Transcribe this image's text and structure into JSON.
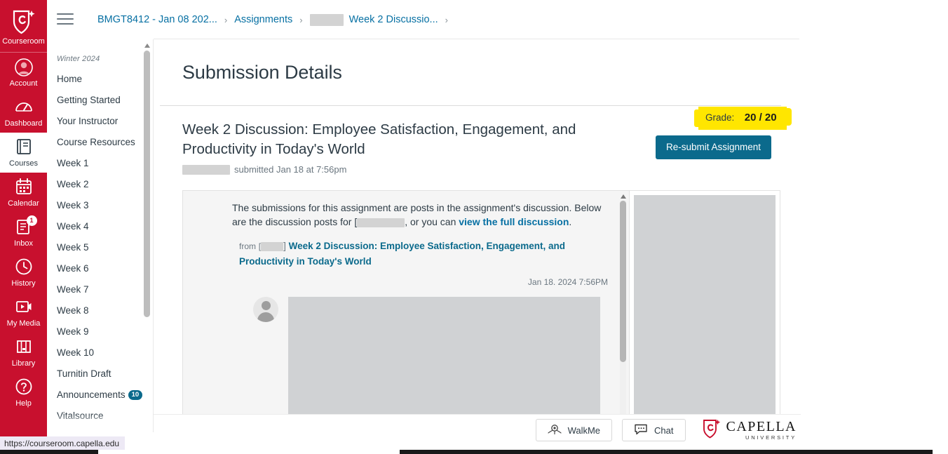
{
  "global_nav": {
    "brand": {
      "label": "Courseroom",
      "icon": "capella-shield-icon"
    },
    "items": [
      {
        "label": "Account",
        "icon": "account-icon",
        "badge": null,
        "active": false
      },
      {
        "label": "Dashboard",
        "icon": "dashboard-icon",
        "badge": null,
        "active": false
      },
      {
        "label": "Courses",
        "icon": "courses-book-icon",
        "badge": null,
        "active": true
      },
      {
        "label": "Calendar",
        "icon": "calendar-icon",
        "badge": null,
        "active": false
      },
      {
        "label": "Inbox",
        "icon": "inbox-icon",
        "badge": "1",
        "active": false
      },
      {
        "label": "History",
        "icon": "history-clock-icon",
        "badge": null,
        "active": false
      },
      {
        "label": "My Media",
        "icon": "my-media-video-icon",
        "badge": null,
        "active": false
      },
      {
        "label": "Library",
        "icon": "library-books-icon",
        "badge": null,
        "active": false
      },
      {
        "label": "Help",
        "icon": "help-question-icon",
        "badge": null,
        "active": false
      }
    ]
  },
  "course_nav": {
    "term": "Winter 2024",
    "items": [
      {
        "label": "Home",
        "badge": null
      },
      {
        "label": "Getting Started",
        "badge": null
      },
      {
        "label": "Your Instructor",
        "badge": null
      },
      {
        "label": "Course Resources",
        "badge": null
      },
      {
        "label": "Week 1",
        "badge": null
      },
      {
        "label": "Week 2",
        "badge": null
      },
      {
        "label": "Week 3",
        "badge": null
      },
      {
        "label": "Week 4",
        "badge": null
      },
      {
        "label": "Week 5",
        "badge": null
      },
      {
        "label": "Week 6",
        "badge": null
      },
      {
        "label": "Week 7",
        "badge": null
      },
      {
        "label": "Week 8",
        "badge": null
      },
      {
        "label": "Week 9",
        "badge": null
      },
      {
        "label": "Week 10",
        "badge": null
      },
      {
        "label": "Turnitin Draft",
        "badge": null
      },
      {
        "label": "Announcements",
        "badge": "10"
      },
      {
        "label": "Vitalsource",
        "badge": null
      }
    ]
  },
  "topbar": {
    "menu_icon": "hamburger-icon",
    "breadcrumbs": [
      {
        "label": "BMGT8412 - Jan 08 202...",
        "link": true,
        "redacted": false
      },
      {
        "label": "Assignments",
        "link": true,
        "redacted": false
      },
      {
        "label": "Week 2 Discussio...",
        "link": true,
        "redacted": true
      }
    ],
    "separator": "›"
  },
  "main": {
    "page_title": "Submission Details",
    "grade": {
      "label": "Grade:",
      "value": "20 / 20",
      "highlight_color": "#FFE600"
    },
    "assignment": {
      "title": "Week 2 Discussion: Employee Satisfaction, Engagement, and Productivity in Today's World",
      "submitted_text": "submitted Jan 18 at 7:56pm",
      "author_redacted": true
    },
    "resubmit_button": {
      "label": "Re-submit Assignment",
      "color": "#0B6A8C"
    }
  },
  "submission": {
    "intro_part1": "The submissions for this assignment are posts in the assignment's discussion. Below are the discussion posts for ",
    "intro_redacted_prefix": "[",
    "intro_part2": ", or you can ",
    "intro_link": "view the full discussion",
    "intro_end": ".",
    "from_label": "from",
    "from_bracket_open": "[",
    "from_bracket_close": "]",
    "post_title": "Week 2 Discussion: Employee Satisfaction, Engagement, and Productivity in Today's World",
    "post_date": "Jan 18. 2024 7:56PM",
    "post_body_redacted": true,
    "document_preview_redacted": true
  },
  "footer": {
    "buttons": [
      {
        "label": "WalkMe",
        "icon": "walkme-pin-icon"
      },
      {
        "label": "Chat",
        "icon": "chat-bubble-icon"
      }
    ],
    "logo": {
      "word": "CAPELLA",
      "sub": "UNIVERSITY",
      "icon": "capella-shield-icon"
    }
  },
  "status_bar": {
    "url": "https://courseroom.capella.edu"
  }
}
